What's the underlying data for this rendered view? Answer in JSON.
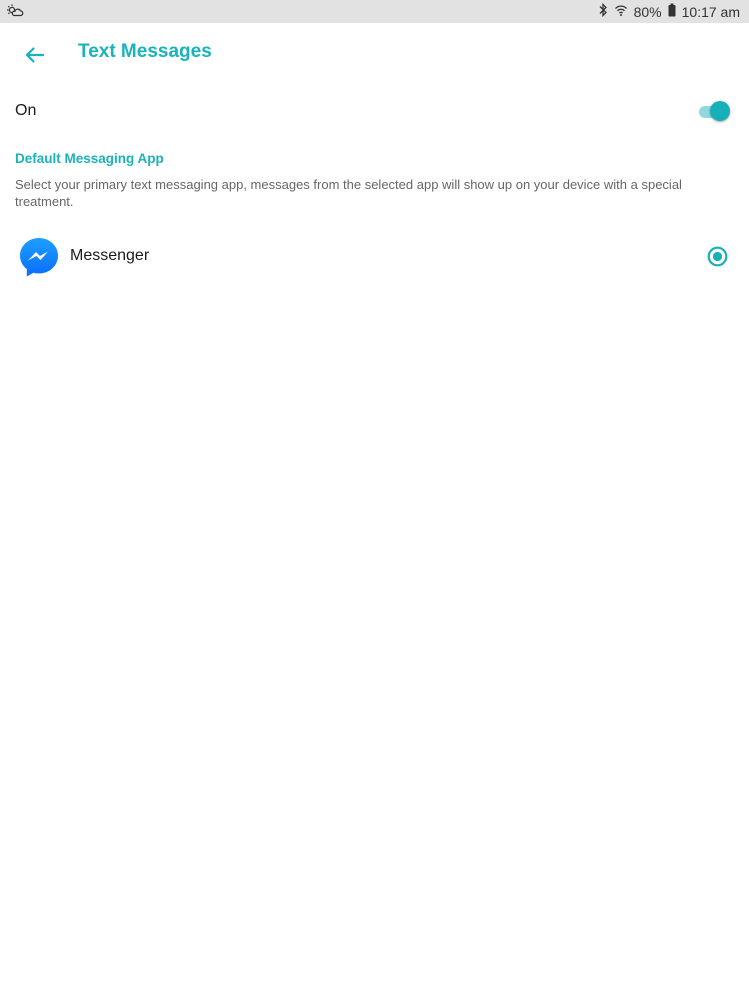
{
  "status_bar": {
    "battery_percent": "80%",
    "time": "10:17 am",
    "icons": [
      "weather-cloud-icon",
      "bluetooth-icon",
      "wifi-icon",
      "battery-icon"
    ]
  },
  "header": {
    "title": "Text Messages",
    "back_icon": "arrow-left-icon"
  },
  "toggle": {
    "label": "On",
    "state": true
  },
  "default_app": {
    "section_title": "Default Messaging App",
    "description": "Select your primary text messaging app, messages from the selected app will show up on your device with a special treatment.",
    "apps": [
      {
        "name": "Messenger",
        "icon": "messenger-icon",
        "selected": true
      }
    ]
  },
  "colors": {
    "accent": "#1ab3bb",
    "toggle_track": "#8fd8dc",
    "messenger_blue": "#0a7cff",
    "status_bar_bg": "#e2e2e2"
  }
}
